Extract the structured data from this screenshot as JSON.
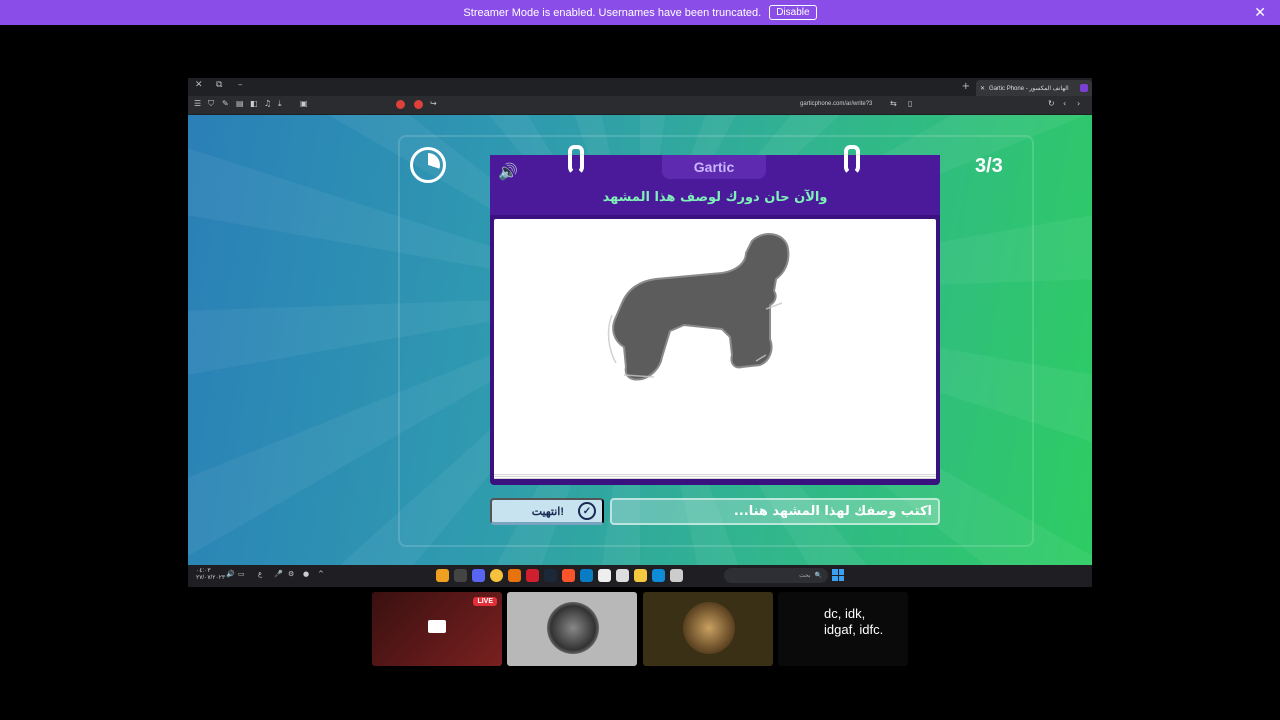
{
  "banner": {
    "text": "Streamer Mode is enabled. Usernames have been truncated.",
    "disable_label": "Disable"
  },
  "browser": {
    "tab_title": "Gartic Phone - الهاتف المكسور",
    "url": "garticphone.com/ar/write?3"
  },
  "game": {
    "logo": "Gartic",
    "prompt": "والآن حان دورك لوصف هذا المشهد",
    "round_counter": "3/3",
    "done_label": "انتهيت!",
    "input_placeholder": "اكتب وصفك لهذا المشهد هنا...",
    "timer_progress": 0.3
  },
  "taskbar": {
    "clock_time": "٠٤:٠٣",
    "clock_date": "٢٧/٠٧/٢٠٢٣",
    "search_placeholder": "بحث"
  },
  "tiles": [
    {
      "badge": "LIVE"
    },
    {},
    {},
    {
      "text": "dc, idk, idgaf, idfc."
    }
  ]
}
